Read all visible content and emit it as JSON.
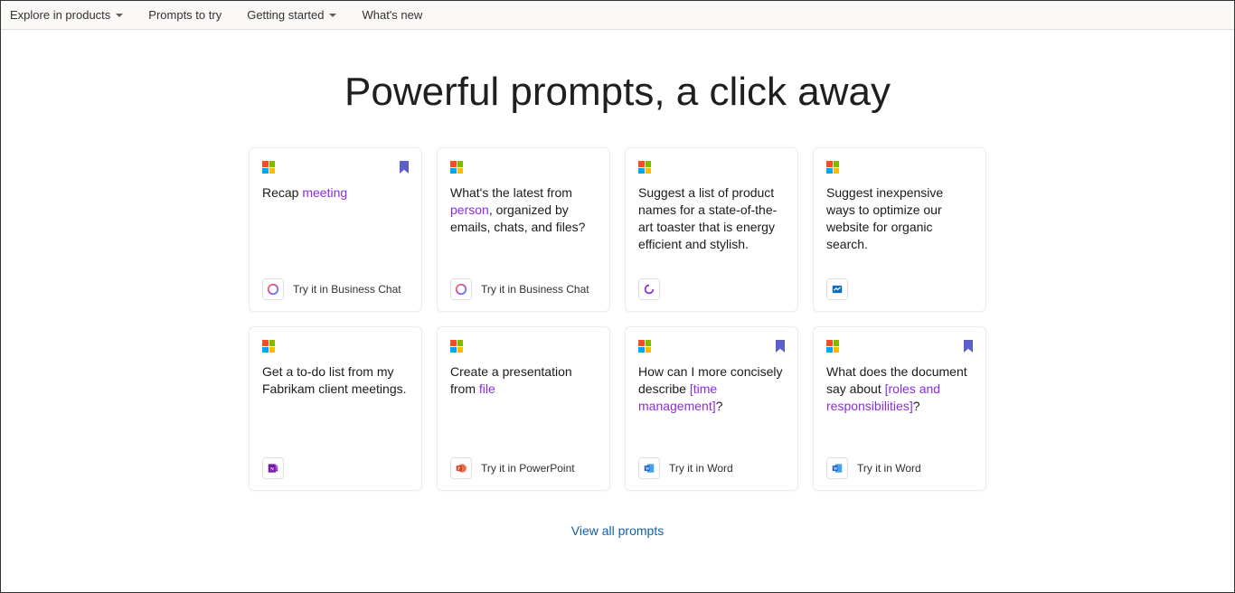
{
  "nav": {
    "explore": "Explore in products",
    "prompts": "Prompts to try",
    "getting_started": "Getting started",
    "whats_new": "What's new"
  },
  "hero": {
    "title": "Powerful prompts, a click away"
  },
  "cards": [
    {
      "bookmarked": true,
      "text_pre": "Recap ",
      "text_hl": "meeting",
      "text_post": "",
      "cta": "Try it in Business Chat",
      "app": "copilot"
    },
    {
      "bookmarked": false,
      "text_pre": "What's the latest from ",
      "text_hl": "person",
      "text_post": ", organized by emails, chats, and files?",
      "cta": "Try it in Business Chat",
      "app": "copilot"
    },
    {
      "bookmarked": false,
      "text_pre": "Suggest a list of product names for a state-of-the-art toaster that is energy efficient and stylish.",
      "text_hl": "",
      "text_post": "",
      "cta": "",
      "app": "loop"
    },
    {
      "bookmarked": false,
      "text_pre": "Suggest inexpensive ways to optimize our website for organic search.",
      "text_hl": "",
      "text_post": "",
      "cta": "",
      "app": "whiteboard"
    },
    {
      "bookmarked": false,
      "text_pre": "Get a to-do list from my Fabrikam client meetings.",
      "text_hl": "",
      "text_post": "",
      "cta": "",
      "app": "onenote"
    },
    {
      "bookmarked": false,
      "text_pre": "Create a presentation from ",
      "text_hl": "file",
      "text_post": "",
      "cta": "Try it in PowerPoint",
      "app": "powerpoint"
    },
    {
      "bookmarked": true,
      "text_pre": "How can I more concisely describe ",
      "text_hl": "[time management]",
      "text_post": "?",
      "cta": "Try it in Word",
      "app": "word"
    },
    {
      "bookmarked": true,
      "text_pre": "What does the document say about ",
      "text_hl": "[roles and responsibilities]",
      "text_post": "?",
      "cta": "Try it in Word",
      "app": "word"
    }
  ],
  "view_all": "View all prompts",
  "app_icons": {
    "copilot": "copilot-icon",
    "loop": "loop-icon",
    "whiteboard": "whiteboard-icon",
    "onenote": "onenote-icon",
    "powerpoint": "powerpoint-icon",
    "word": "word-icon"
  }
}
